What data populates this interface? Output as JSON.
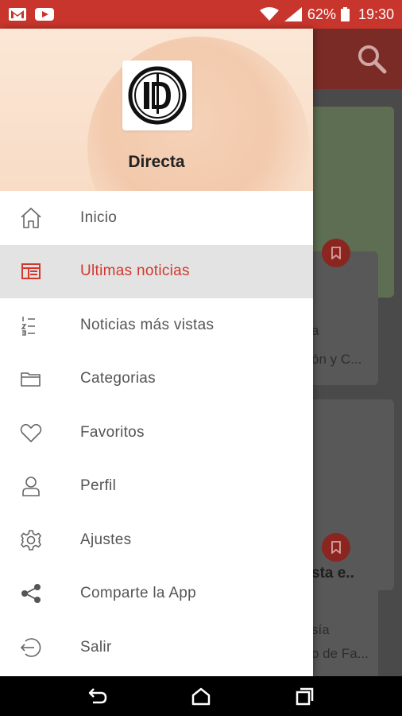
{
  "status_bar": {
    "battery_percent": "62%",
    "time": "19:30",
    "icons": [
      "gmail-icon",
      "youtube-icon",
      "wifi-icon",
      "signal-icon",
      "battery-icon"
    ]
  },
  "drawer": {
    "brand": "Directa",
    "items": [
      {
        "label": "Inicio",
        "icon": "home-icon",
        "active": false
      },
      {
        "label": "Ultimas noticias",
        "icon": "news-icon",
        "active": true
      },
      {
        "label": "Noticias más vistas",
        "icon": "ranked-list-icon",
        "active": false
      },
      {
        "label": "Categorias",
        "icon": "folder-icon",
        "active": false
      },
      {
        "label": "Favoritos",
        "icon": "heart-icon",
        "active": false
      },
      {
        "label": "Perfil",
        "icon": "user-icon",
        "active": false
      },
      {
        "label": "Ajustes",
        "icon": "gear-icon",
        "active": false
      },
      {
        "label": "Comparte la App",
        "icon": "share-icon",
        "active": false
      },
      {
        "label": "Salir",
        "icon": "logout-icon",
        "active": false
      }
    ]
  },
  "background": {
    "card1_snippet": "ón y C...",
    "card1_letter": "a",
    "card2_title": "sta e..",
    "card2_line1": "sía",
    "card2_line2": "o de Fa..."
  },
  "colors": {
    "accent": "#d1382e",
    "status_bar": "#c7352c"
  }
}
